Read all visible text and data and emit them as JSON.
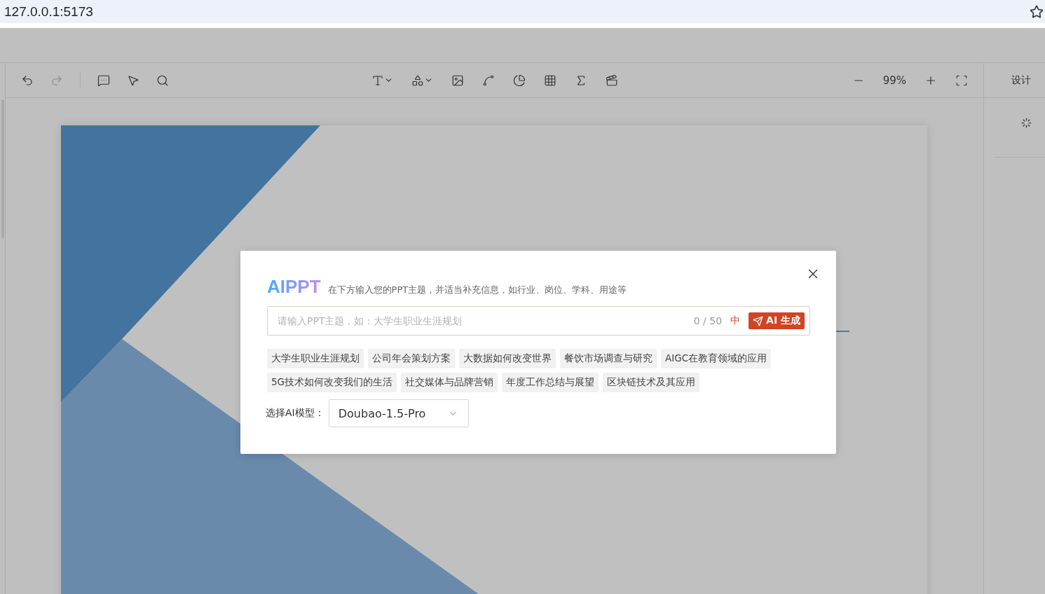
{
  "browser": {
    "address": "127.0.0.1:5173"
  },
  "toolbar": {
    "history": [
      {
        "kind": "undo",
        "disabled": false
      },
      {
        "kind": "redo",
        "disabled": true
      }
    ],
    "zoom": "99%"
  },
  "right_panel": {
    "tab": "设计"
  },
  "dialog": {
    "brand": "AIPPT",
    "hint": "在下方输入您的PPT主题，并适当补充信息，如行业、岗位、学科、用途等",
    "input": {
      "placeholder": "请输入PPT主题，如：大学生职业生涯规划",
      "counter": "0 / 50",
      "language": "中",
      "submit": "AI 生成"
    },
    "suggestions": [
      "大学生职业生涯规划",
      "公司年会策划方案",
      "大数据如何改变世界",
      "餐饮市场调查与研究",
      "AIGC在教育领域的应用",
      "5G技术如何改变我们的生活",
      "社交媒体与品牌营销",
      "年度工作总结与展望",
      "区块链技术及其应用"
    ],
    "model": {
      "label": "选择AI模型：",
      "value": "Doubao-1.5-Pro"
    }
  }
}
